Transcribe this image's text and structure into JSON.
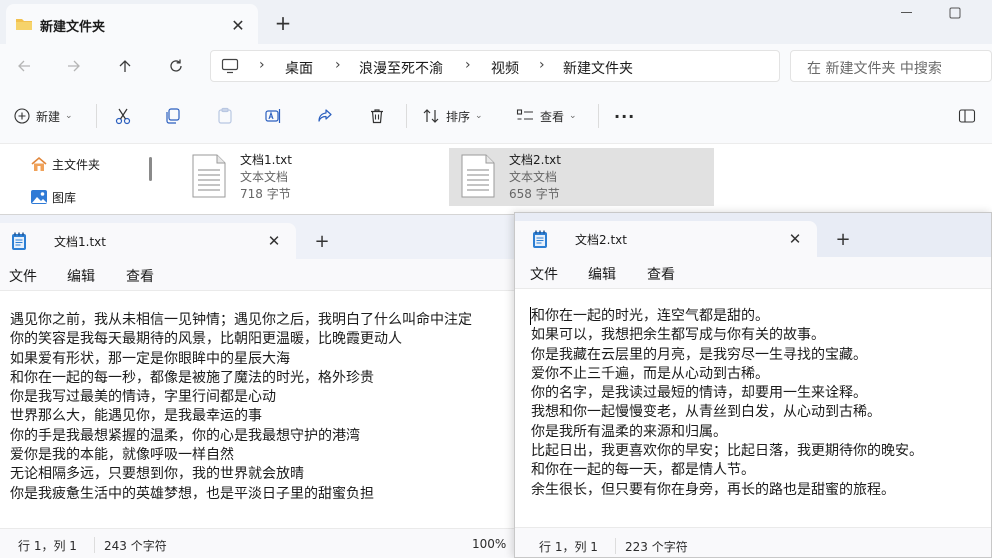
{
  "explorer": {
    "tab_title": "新建文件夹",
    "breadcrumb": [
      "桌面",
      "浪漫至死不渝",
      "视频",
      "新建文件夹"
    ],
    "search_placeholder": "在 新建文件夹 中搜索",
    "toolbar": {
      "new_label": "新建",
      "sort_label": "排序",
      "view_label": "查看"
    },
    "sidebar": [
      {
        "label": "主文件夹",
        "icon": "home-icon"
      },
      {
        "label": "图库",
        "icon": "gallery-icon"
      }
    ],
    "files": [
      {
        "name": "文档1.txt",
        "type": "文本文档",
        "size": "718 字节",
        "selected": false
      },
      {
        "name": "文档2.txt",
        "type": "文本文档",
        "size": "658 字节",
        "selected": true
      }
    ]
  },
  "notepad1": {
    "tab_title": "文档1.txt",
    "menu": [
      "文件",
      "编辑",
      "查看"
    ],
    "lines": [
      "遇见你之前，我从未相信一见钟情；遇见你之后，我明白了什么叫命中注定",
      "你的笑容是我每天最期待的风景，比朝阳更温暖，比晚霞更动人",
      "如果爱有形状，那一定是你眼眸中的星辰大海",
      "和你在一起的每一秒，都像是被施了魔法的时光，格外珍贵",
      "你是我写过最美的情诗，字里行间都是心动",
      "世界那么大，能遇见你，是我最幸运的事",
      "你的手是我最想紧握的温柔，你的心是我最想守护的港湾",
      "爱你是我的本能，就像呼吸一样自然",
      "无论相隔多远，只要想到你，我的世界就会放晴",
      "你是我疲惫生活中的英雄梦想，也是平淡日子里的甜蜜负担"
    ],
    "status": {
      "position": "行 1，列 1",
      "chars": "243 个字符",
      "zoom": "100%"
    }
  },
  "notepad2": {
    "tab_title": "文档2.txt",
    "menu": [
      "文件",
      "编辑",
      "查看"
    ],
    "lines": [
      "和你在一起的时光，连空气都是甜的。",
      "如果可以，我想把余生都写成与你有关的故事。",
      "你是我藏在云层里的月亮，是我穷尽一生寻找的宝藏。",
      "爱你不止三千遍，而是从心动到古稀。",
      "你的名字，是我读过最短的情诗，却要用一生来诠释。",
      "我想和你一起慢慢变老，从青丝到白发，从心动到古稀。",
      "你是我所有温柔的来源和归属。",
      "比起日出，我更喜欢你的早安；比起日落，我更期待你的晚安。",
      "和你在一起的每一天，都是情人节。",
      "余生很长，但只要有你在身旁，再长的路也是甜蜜的旅程。"
    ],
    "status": {
      "position": "行 1，列 1",
      "chars": "223 个字符"
    }
  }
}
